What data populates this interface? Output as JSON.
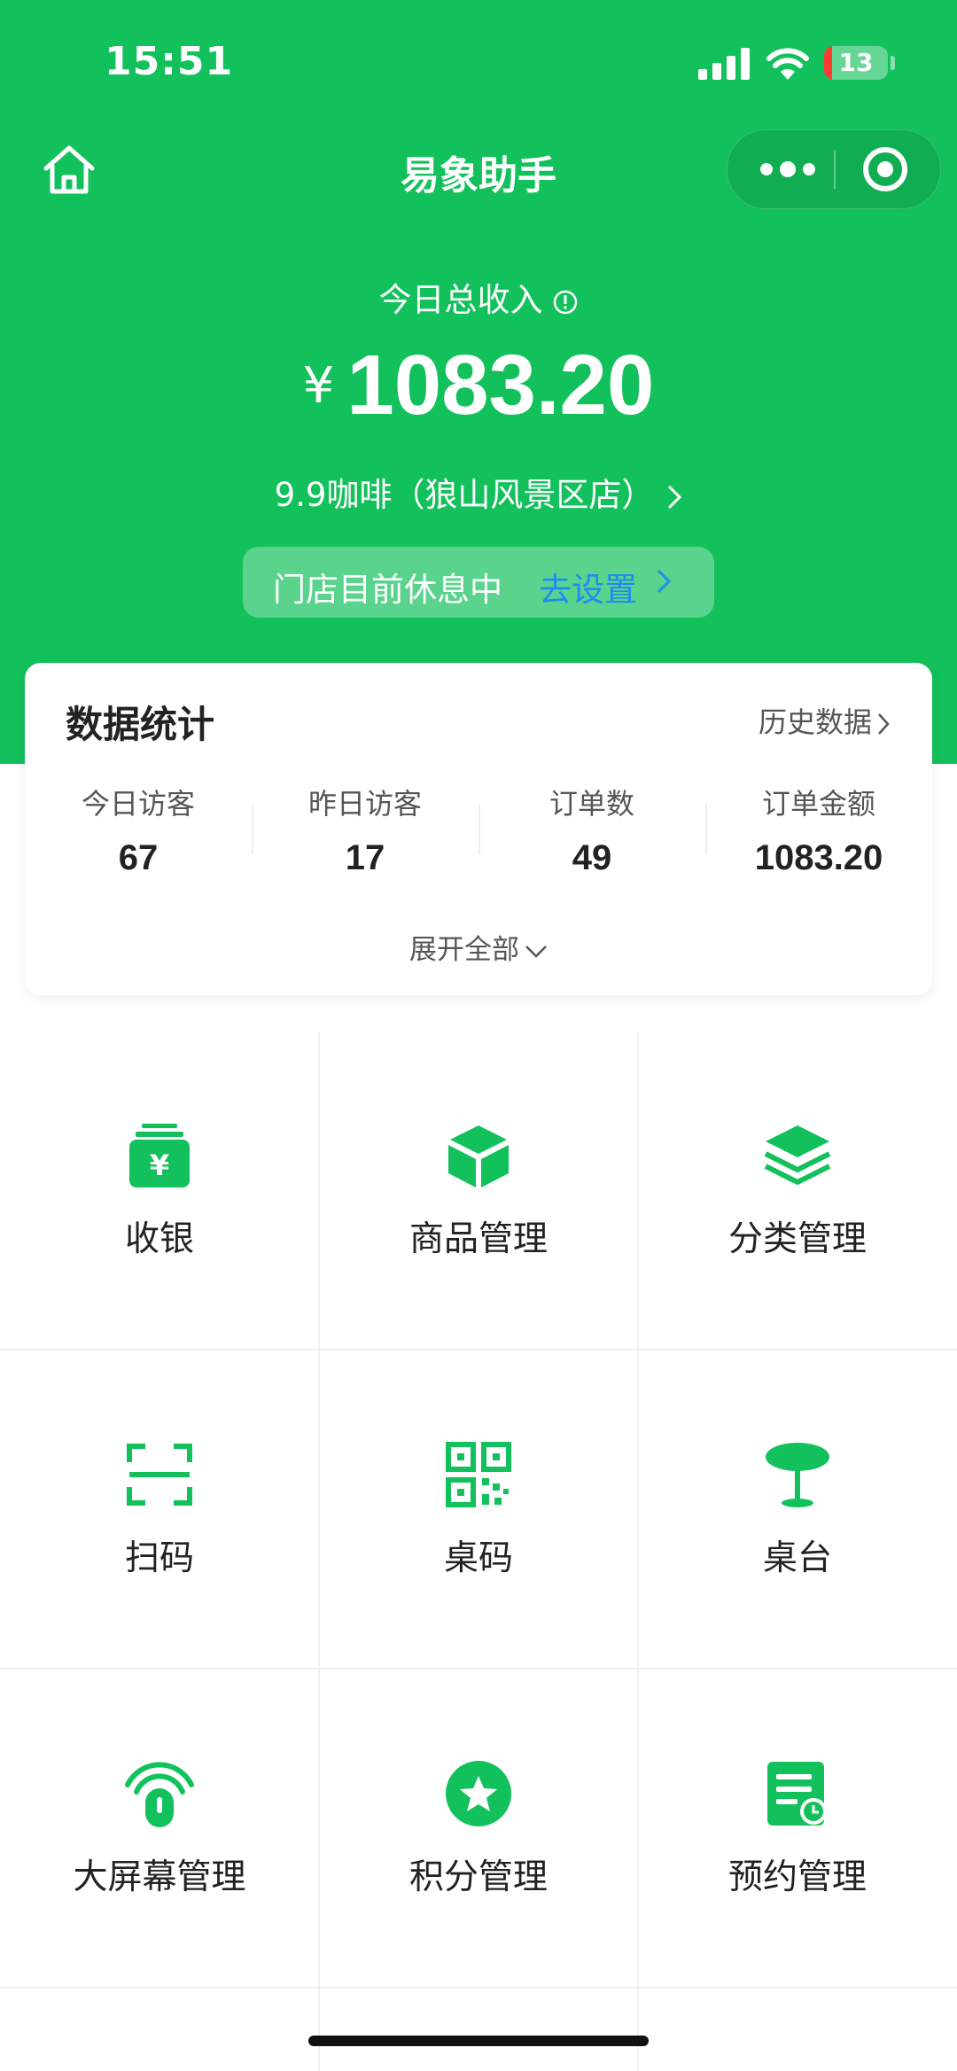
{
  "status_bar": {
    "time": "15:51",
    "battery": "13"
  },
  "nav": {
    "title": "易象助手"
  },
  "income": {
    "label": "今日总收入",
    "currency": "¥",
    "amount": "1083.20",
    "store_name": "9.9咖啡（狼山风景区店）"
  },
  "store_status": {
    "text": "门店目前休息中",
    "action": "去设置"
  },
  "stats": {
    "title": "数据统计",
    "history_link": "历史数据",
    "items": [
      {
        "label": "今日访客",
        "value": "67"
      },
      {
        "label": "昨日访客",
        "value": "17"
      },
      {
        "label": "订单数",
        "value": "49"
      },
      {
        "label": "订单金额",
        "value": "1083.20"
      }
    ],
    "expand_label": "展开全部"
  },
  "menu": [
    {
      "label": "收银",
      "icon": "cashier-icon"
    },
    {
      "label": "商品管理",
      "icon": "box-icon"
    },
    {
      "label": "分类管理",
      "icon": "layers-icon"
    },
    {
      "label": "扫码",
      "icon": "scan-icon"
    },
    {
      "label": "桌码",
      "icon": "qr-code-icon"
    },
    {
      "label": "桌台",
      "icon": "table-icon"
    },
    {
      "label": "大屏幕管理",
      "icon": "big-screen-icon"
    },
    {
      "label": "积分管理",
      "icon": "points-star-icon"
    },
    {
      "label": "预约管理",
      "icon": "reservation-icon"
    }
  ],
  "colors": {
    "brand_green": "#13c15c",
    "link_blue": "#1d8cf4"
  }
}
